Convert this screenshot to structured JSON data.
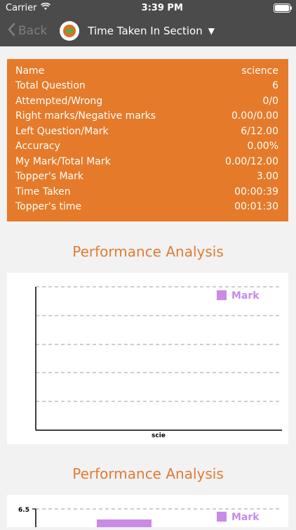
{
  "status_bar": {
    "carrier": "Carrier",
    "time": "3:39 PM",
    "icons": [
      "wifi-icon",
      "battery-icon"
    ]
  },
  "nav": {
    "back_label": "Back",
    "title": "Time Taken In Section",
    "icons": [
      "chevron-left-icon",
      "app-logo-icon",
      "caret-down-icon"
    ]
  },
  "stats": [
    {
      "label": "Name",
      "value": "science"
    },
    {
      "label": "Total Question",
      "value": "6"
    },
    {
      "label": "Attempted/Wrong",
      "value": "0/0"
    },
    {
      "label": "Right marks/Negative marks",
      "value": "0.00/0.00"
    },
    {
      "label": "Left Question/Mark",
      "value": "6/12.00"
    },
    {
      "label": "Accuracy",
      "value": "0.00%"
    },
    {
      "label": "My Mark/Total Mark",
      "value": "0.00/12.00"
    },
    {
      "label": "Topper's Mark",
      "value": "3.00"
    },
    {
      "label": "Time Taken",
      "value": "00:00:39"
    },
    {
      "label": "Topper's time",
      "value": "00:01:30"
    }
  ],
  "sections": [
    {
      "title": "Performance Analysis"
    },
    {
      "title": "Performance Analysis"
    }
  ],
  "colors": {
    "nav_bg": "#4b4b4b",
    "accent_orange": "#e57a2a",
    "title_orange": "#e07c33",
    "legend_purple": "#c98be6",
    "bar_purple": "#c98be6",
    "grid_gray": "#b0b0b0"
  },
  "chart_data": [
    {
      "type": "bar",
      "categories": [
        "scie"
      ],
      "series": [
        {
          "name": "Mark",
          "values": [
            0
          ]
        }
      ],
      "legend": "top-right",
      "grid": true
    },
    {
      "type": "bar",
      "series": [
        {
          "name": "Mark"
        }
      ],
      "yticks": [
        "6.5"
      ],
      "legend": "top-right",
      "grid": true
    }
  ]
}
